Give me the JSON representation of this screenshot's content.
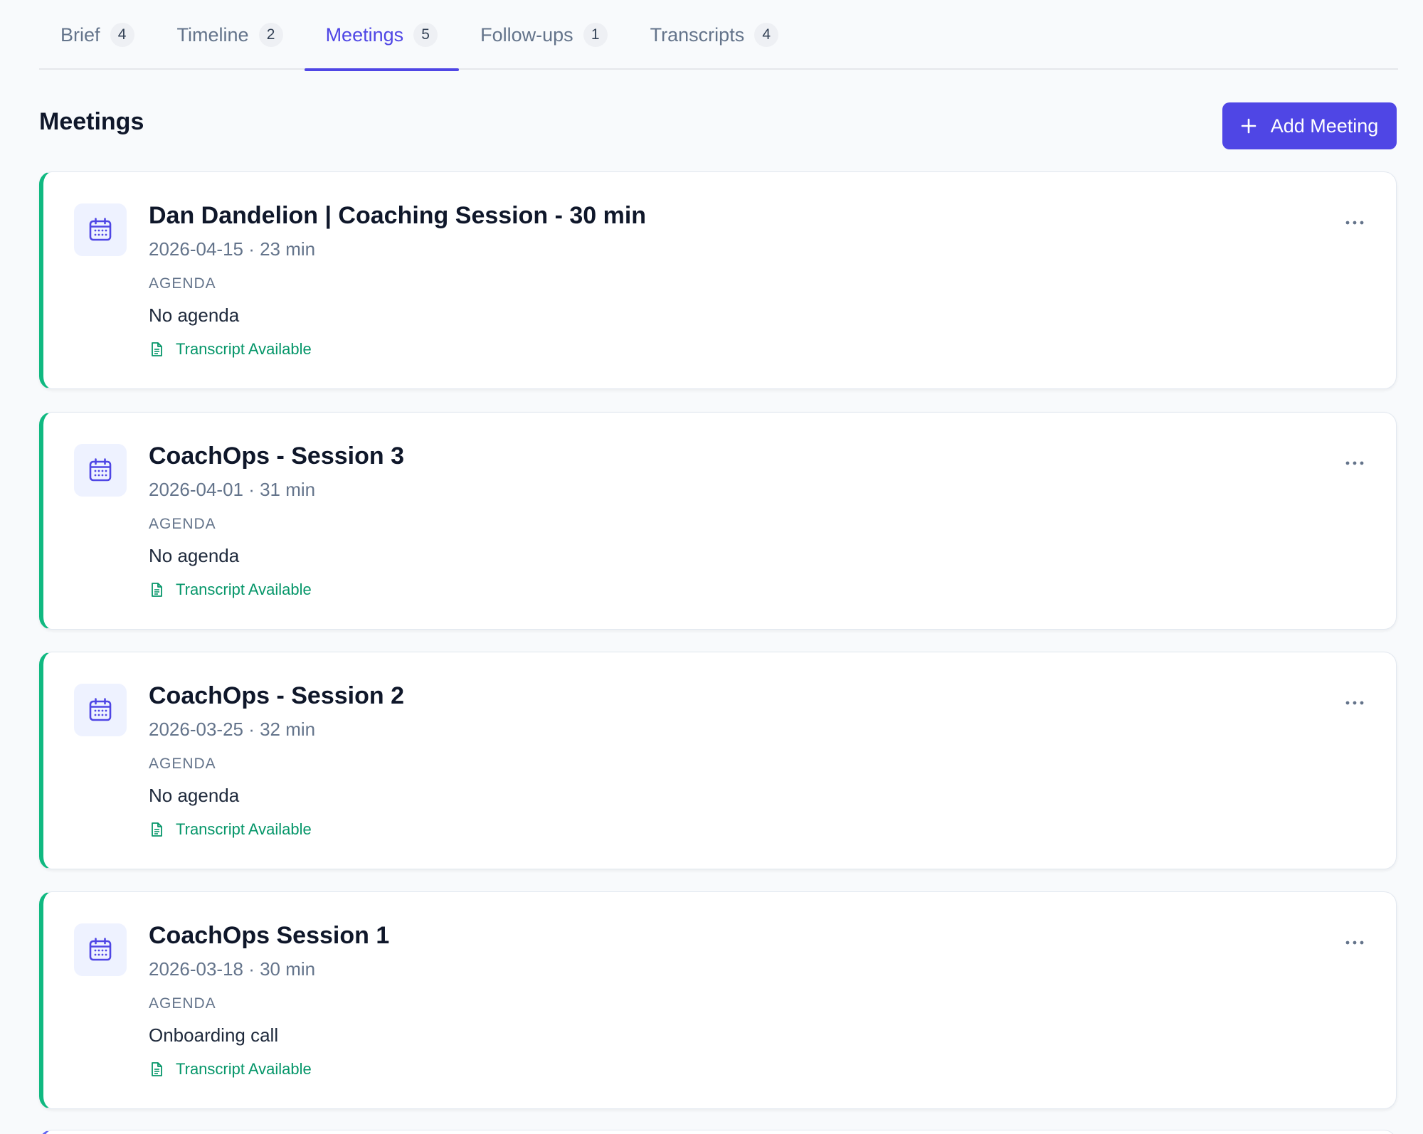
{
  "tabs": [
    {
      "label": "Brief",
      "count": "4"
    },
    {
      "label": "Timeline",
      "count": "2"
    },
    {
      "label": "Meetings",
      "count": "5"
    },
    {
      "label": "Follow-ups",
      "count": "1"
    },
    {
      "label": "Transcripts",
      "count": "4"
    }
  ],
  "active_tab": "Meetings",
  "header": {
    "title": "Meetings",
    "add_button_label": "Add Meeting"
  },
  "meetings": [
    {
      "title": "Dan Dandelion | Coaching Session - 30 min",
      "meta": "2026-04-15 · 23 min",
      "agenda_label": "AGENDA",
      "agenda": "No agenda",
      "transcript_label": "Transcript Available"
    },
    {
      "title": "CoachOps - Session 3",
      "meta": "2026-04-01 · 31 min",
      "agenda_label": "AGENDA",
      "agenda": "No agenda",
      "transcript_label": "Transcript Available"
    },
    {
      "title": "CoachOps - Session 2",
      "meta": "2026-03-25 · 32 min",
      "agenda_label": "AGENDA",
      "agenda": "No agenda",
      "transcript_label": "Transcript Available"
    },
    {
      "title": "CoachOps Session 1",
      "meta": "2026-03-18 · 30 min",
      "agenda_label": "AGENDA",
      "agenda": "Onboarding call",
      "transcript_label": "Transcript Available"
    }
  ],
  "icons": {
    "card_icon": "calendar-icon",
    "transcript_icon": "document-icon",
    "menu_icon": "more-horizontal-icon",
    "add_icon": "plus-icon"
  },
  "colors": {
    "accent": "#4f46e5",
    "success": "#059669",
    "card_border_accent": "#10b981",
    "background": "#f8fafc"
  }
}
